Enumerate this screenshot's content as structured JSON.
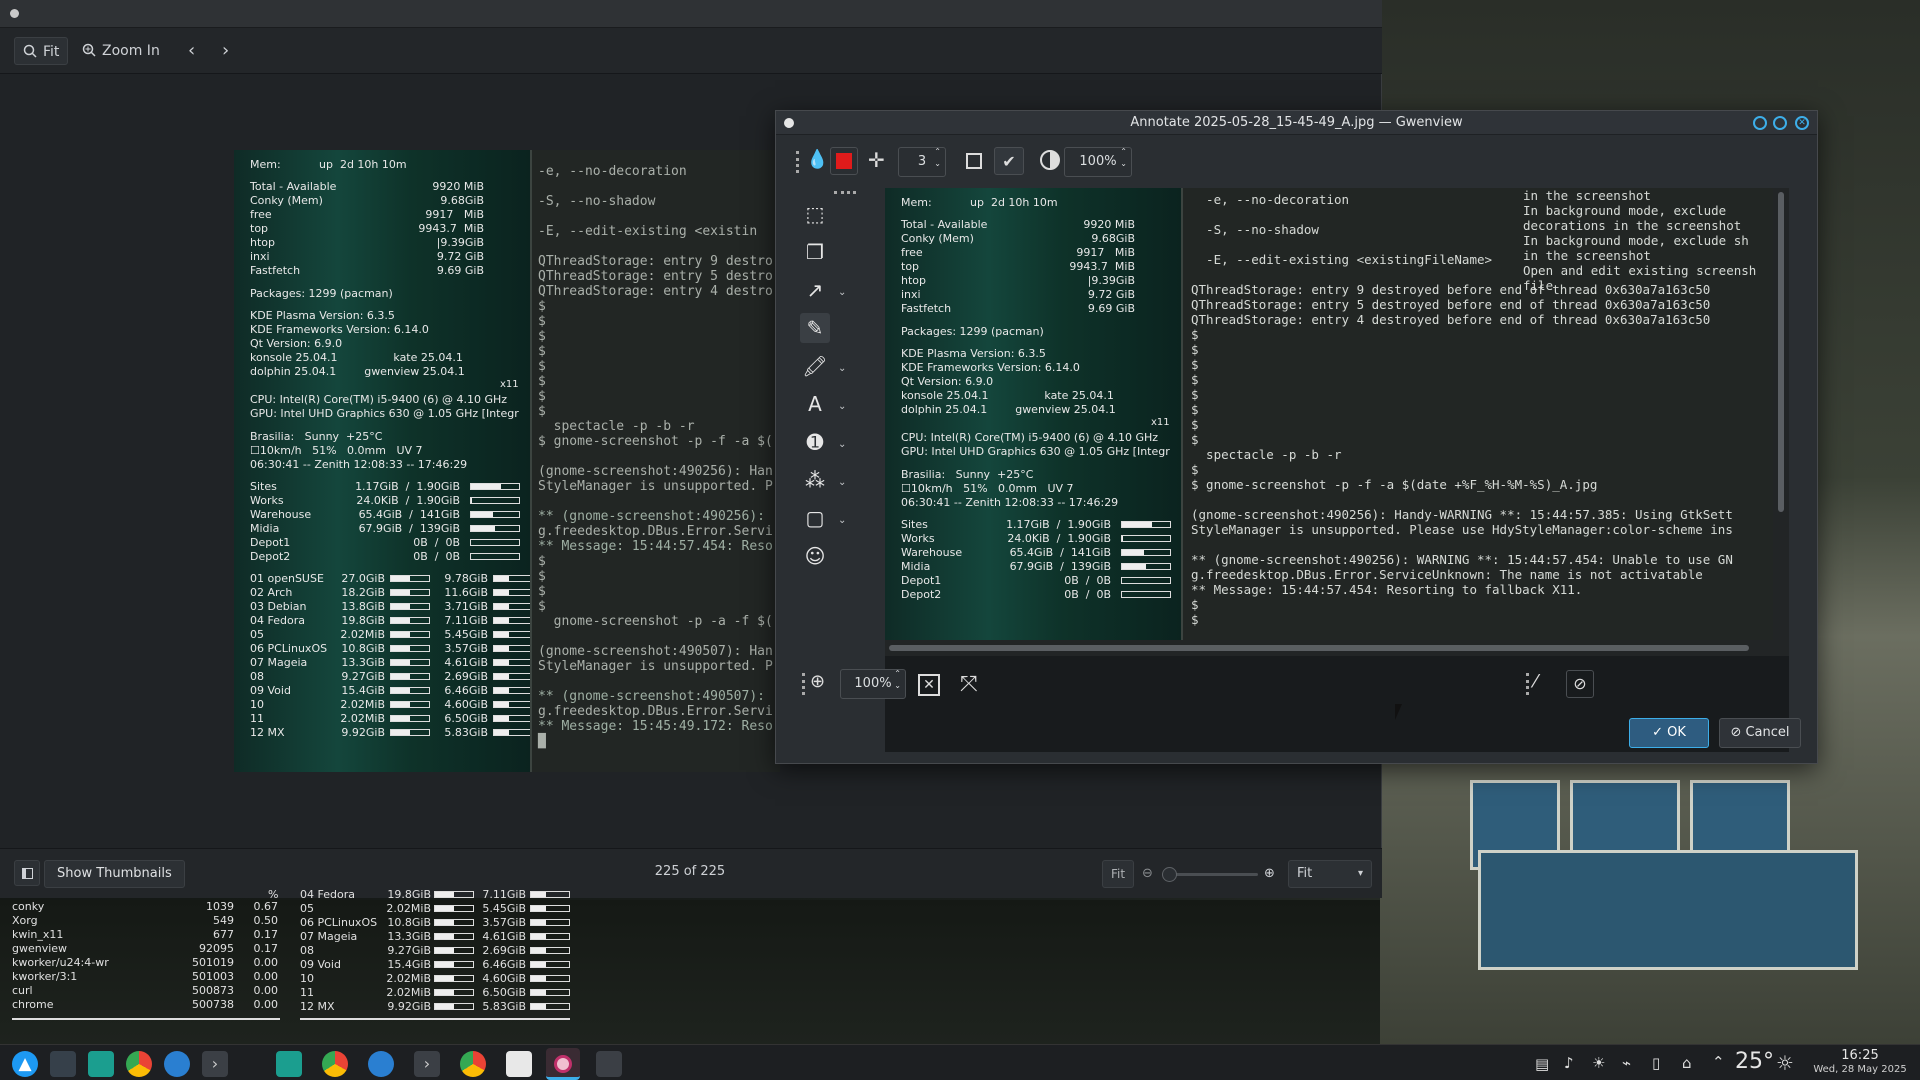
{
  "viewer": {
    "toolbar": {
      "fit": "Fit",
      "zoom_in": "Zoom In"
    },
    "bottom": {
      "show_thumbnails": "Show Thumbnails",
      "counter": "225 of 225",
      "fit": "Fit",
      "fit_select": "Fit"
    }
  },
  "conky": {
    "mem": "Mem:",
    "uptime": "up  2d 10h 10m",
    "mem_rows": [
      [
        "Total - Available",
        "9920 MiB"
      ],
      [
        "Conky (Mem)",
        "9.68GiB"
      ],
      [
        "free",
        "9917   MiB"
      ],
      [
        "top",
        "9943.7  MiB"
      ],
      [
        "htop",
        "|9.39GiB"
      ],
      [
        "inxi",
        "9.72 GiB"
      ],
      [
        "Fastfetch",
        "9.69 GiB"
      ]
    ],
    "packages": "Packages: 1299 (pacman)",
    "versions": [
      "KDE Plasma Version: 6.3.5",
      "KDE Frameworks Version: 6.14.0",
      "Qt Version: 6.9.0",
      "konsole 25.04.1                kate 25.04.1",
      "dolphin 25.04.1        gwenview 25.04.1"
    ],
    "x11": "x11",
    "cpu": "CPU: Intel(R) Core(TM) i5-9400 (6) @ 4.10 GHz",
    "gpu": "GPU: Intel UHD Graphics 630 @ 1.05 GHz [Integr",
    "weather": [
      "Brasilia:   Sunny  +25°C",
      "☐10km/h   51%   0.0mm   UV 7",
      "06:30:41 -- Zenith 12:08:33 -- 17:46:29"
    ],
    "disks": [
      [
        "Sites",
        "1.17GiB  /  1.90GiB",
        0.62
      ],
      [
        "Works",
        "24.0KiB  /  1.90GiB",
        0.02
      ],
      [
        "Warehouse",
        "65.4GiB  /  141GiB",
        0.46
      ],
      [
        "Midia",
        "67.9GiB  /  139GiB",
        0.49
      ],
      [
        "Depot1",
        "0B  /  0B",
        0
      ],
      [
        "Depot2",
        "0B  /  0B",
        0
      ]
    ],
    "distros": [
      [
        "01 openSUSE",
        "27.0GiB",
        "9.78GiB"
      ],
      [
        "02 Arch",
        "18.2GiB",
        "11.6GiB"
      ],
      [
        "03 Debian",
        "13.8GiB",
        "3.71GiB"
      ],
      [
        "04 Fedora",
        "19.8GiB",
        "7.11GiB"
      ],
      [
        "05",
        "2.02MiB",
        "5.45GiB"
      ],
      [
        "06 PCLinuxOS",
        "10.8GiB",
        "3.57GiB"
      ],
      [
        "07 Mageia",
        "13.3GiB",
        "4.61GiB"
      ],
      [
        "08",
        "9.27GiB",
        "2.69GiB"
      ],
      [
        "09 Void",
        "15.4GiB",
        "6.46GiB"
      ],
      [
        "10",
        "2.02MiB",
        "4.60GiB"
      ],
      [
        "11",
        "2.02MiB",
        "6.50GiB"
      ],
      [
        "12 MX",
        "9.92GiB",
        "5.83GiB"
      ]
    ]
  },
  "terminal_small": [
    "-e, --no-decoration",
    "",
    "-S, --no-shadow",
    "",
    "-E, --edit-existing <existin",
    "",
    "QThreadStorage: entry 9 destro",
    "QThreadStorage: entry 5 destro",
    "QThreadStorage: entry 4 destro",
    "$",
    "$",
    "$",
    "$",
    "$",
    "$",
    "$",
    "$",
    "  spectacle -p -b -r",
    "$ gnome-screenshot -p -f -a $(",
    "",
    "(gnome-screenshot:490256): Han",
    "StyleManager is unsupported. P",
    "",
    "** (gnome-screenshot:490256):",
    "g.freedesktop.DBus.Error.Servi",
    "** Message: 15:44:57.454: Reso",
    "$",
    "$",
    "$",
    "$",
    "  gnome-screenshot -p -a -f $(",
    "",
    "(gnome-screenshot:490507): Han",
    "StyleManager is unsupported. P",
    "",
    "** (gnome-screenshot:490507):",
    "g.freedesktop.DBus.Error.Servi",
    "** Message: 15:45:49.172: Reso",
    "█"
  ],
  "dialog": {
    "title": "Annotate 2025-05-28_15-45-49_A.jpg — Gwenview",
    "stroke_width": "3",
    "opacity": "100%",
    "zoom": "100%",
    "ok": "OK",
    "cancel": "Cancel",
    "accent": "#3daee9",
    "swatch": "#e01b1b"
  },
  "terminal_big": {
    "right_col": [
      "in the screenshot",
      "In background mode, exclude",
      "decorations in the screenshot",
      "In background mode, exclude sh",
      "in the screenshot",
      "Open and edit existing screensh",
      "file"
    ],
    "lines": [
      "  -e, --no-decoration",
      "",
      "  -S, --no-shadow",
      "",
      "  -E, --edit-existing <existingFileName>",
      "",
      "QThreadStorage: entry 9 destroyed before end of thread 0x630a7a163c50",
      "QThreadStorage: entry 5 destroyed before end of thread 0x630a7a163c50",
      "QThreadStorage: entry 4 destroyed before end of thread 0x630a7a163c50",
      "$",
      "$",
      "$",
      "$",
      "$",
      "$",
      "$",
      "$",
      "  spectacle -p -b -r",
      "$",
      "$ gnome-screenshot -p -f -a $(date +%F_%H-%M-%S)_A.jpg",
      "",
      "(gnome-screenshot:490256): Handy-WARNING **: 15:44:57.385: Using GtkSett",
      "StyleManager is unsupported. Please use HdyStyleManager:color-scheme ins",
      "",
      "** (gnome-screenshot:490256): WARNING **: 15:44:57.454: Unable to use GN",
      "g.freedesktop.DBus.Error.ServiceUnknown: The name is not activatable",
      "** Message: 15:44:57.454: Resorting to fallback X11.",
      "$",
      "$"
    ]
  },
  "desktop_conky": {
    "procs": [
      [
        "conky",
        "1039",
        "0.67"
      ],
      [
        "Xorg",
        "549",
        "0.50"
      ],
      [
        "kwin_x11",
        "677",
        "0.17"
      ],
      [
        "gwenview",
        "92095",
        "0.17"
      ],
      [
        "kworker/u24:4-wr",
        "501019",
        "0.00"
      ],
      [
        "kworker/3:1",
        "501003",
        "0.00"
      ],
      [
        "curl",
        "500873",
        "0.00"
      ],
      [
        "chrome",
        "500738",
        "0.00"
      ]
    ],
    "pct": "%",
    "distros": [
      [
        "04 Fedora",
        "19.8GiB",
        "7.11GiB"
      ],
      [
        "05",
        "2.02MiB",
        "5.45GiB"
      ],
      [
        "06 PCLinuxOS",
        "10.8GiB",
        "3.57GiB"
      ],
      [
        "07 Mageia",
        "13.3GiB",
        "4.61GiB"
      ],
      [
        "08",
        "9.27GiB",
        "2.69GiB"
      ],
      [
        "09 Void",
        "15.4GiB",
        "6.46GiB"
      ],
      [
        "10",
        "2.02MiB",
        "4.60GiB"
      ],
      [
        "11",
        "2.02MiB",
        "6.50GiB"
      ],
      [
        "12 MX",
        "9.92GiB",
        "5.83GiB"
      ]
    ]
  },
  "taskbar": {
    "temp": "25°",
    "time": "16:25",
    "date": "Wed, 28 May 2025"
  }
}
